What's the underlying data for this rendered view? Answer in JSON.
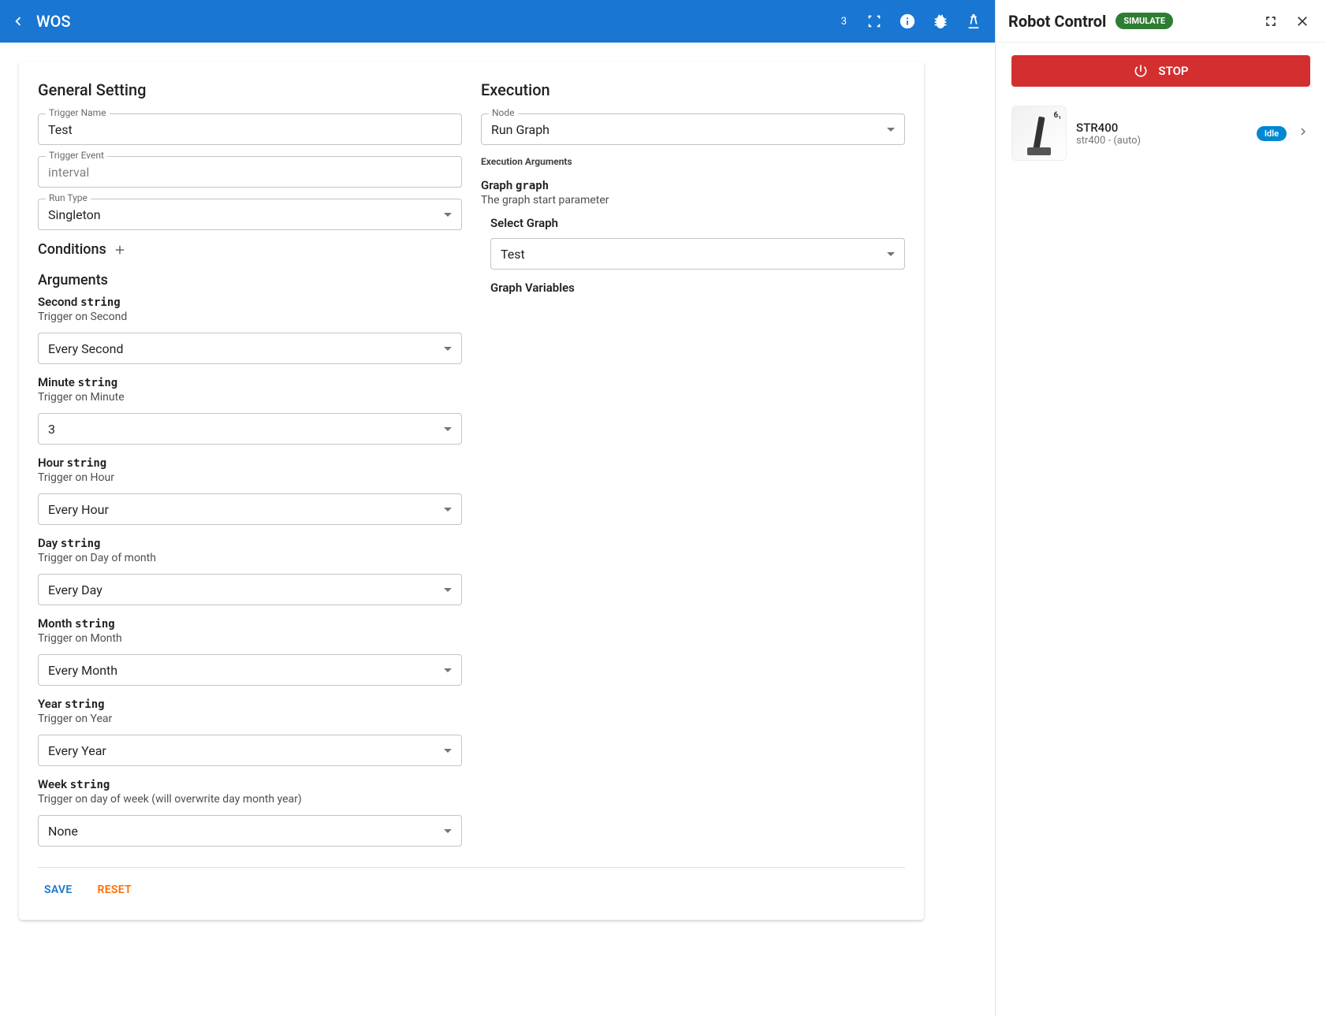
{
  "topbar": {
    "title": "WOS",
    "badge": "3"
  },
  "general": {
    "heading": "General Setting",
    "trigger_name_label": "Trigger Name",
    "trigger_name_value": "Test",
    "trigger_event_label": "Trigger Event",
    "trigger_event_value": "interval",
    "run_type_label": "Run Type",
    "run_type_value": "Singleton"
  },
  "conditions": {
    "heading": "Conditions"
  },
  "arguments": {
    "heading": "Arguments",
    "items": [
      {
        "name": "Second",
        "type": "string",
        "desc": "Trigger on Second",
        "value": "Every Second"
      },
      {
        "name": "Minute",
        "type": "string",
        "desc": "Trigger on Minute",
        "value": "3"
      },
      {
        "name": "Hour",
        "type": "string",
        "desc": "Trigger on Hour",
        "value": "Every Hour"
      },
      {
        "name": "Day",
        "type": "string",
        "desc": "Trigger on Day of month",
        "value": "Every Day"
      },
      {
        "name": "Month",
        "type": "string",
        "desc": "Trigger on Month",
        "value": "Every Month"
      },
      {
        "name": "Year",
        "type": "string",
        "desc": "Trigger on Year",
        "value": "Every Year"
      },
      {
        "name": "Week",
        "type": "string",
        "desc": "Trigger on day of week (will overwrite day month year)",
        "value": "None"
      }
    ]
  },
  "execution": {
    "heading": "Execution",
    "node_label": "Node",
    "node_value": "Run Graph",
    "args_heading": "Execution Arguments",
    "graph": {
      "name": "Graph",
      "type": "graph",
      "desc": "The graph start parameter",
      "select_label": "Select Graph",
      "select_value": "Test",
      "variables_heading": "Graph Variables"
    }
  },
  "footer": {
    "save": "SAVE",
    "reset": "RESET"
  },
  "robot_panel": {
    "title": "Robot Control",
    "simulate": "SIMULATE",
    "stop": "STOP",
    "robot": {
      "name": "STR400",
      "sub": "str400 - (auto)",
      "status": "Idle",
      "thumb_tag": "6₁"
    }
  }
}
